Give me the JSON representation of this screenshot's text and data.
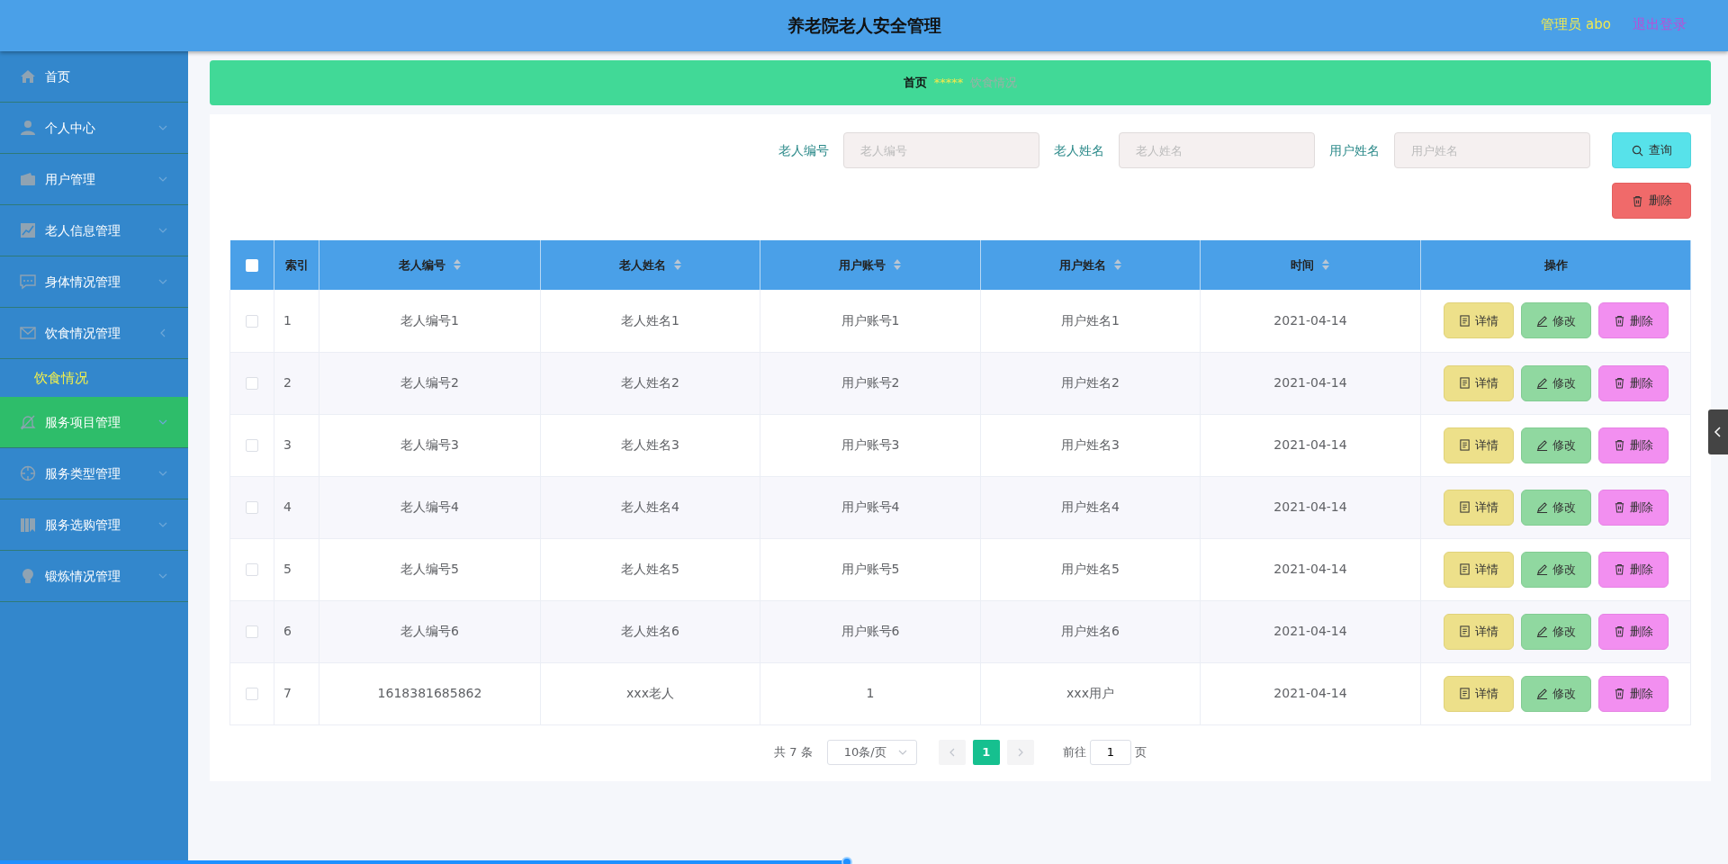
{
  "header": {
    "title": "养老院老人安全管理",
    "user": "管理员 abo",
    "logout": "退出登录"
  },
  "sidebar": {
    "items": [
      {
        "label": "首页",
        "kind": "link",
        "selected": false
      },
      {
        "label": "个人中心",
        "kind": "menu",
        "expanded": false,
        "selected": false
      },
      {
        "label": "用户管理",
        "kind": "menu",
        "expanded": false,
        "selected": false
      },
      {
        "label": "老人信息管理",
        "kind": "menu",
        "expanded": false,
        "selected": false
      },
      {
        "label": "身体情况管理",
        "kind": "menu",
        "expanded": false,
        "selected": false
      },
      {
        "label": "饮食情况管理",
        "kind": "menu",
        "expanded": true,
        "selected": false,
        "children": [
          {
            "label": "饮食情况",
            "selected": false
          }
        ]
      },
      {
        "label": "服务项目管理",
        "kind": "menu",
        "expanded": false,
        "selected": true
      },
      {
        "label": "服务类型管理",
        "kind": "menu",
        "expanded": false,
        "selected": false
      },
      {
        "label": "服务选购管理",
        "kind": "menu",
        "expanded": false,
        "selected": false
      },
      {
        "label": "锻炼情况管理",
        "kind": "menu",
        "expanded": false,
        "selected": false
      }
    ]
  },
  "breadcrumb": {
    "items": [
      "首页",
      "饮食情况"
    ],
    "separator": "*****"
  },
  "search": {
    "fields": [
      {
        "label": "老人编号",
        "placeholder": "老人编号"
      },
      {
        "label": "老人姓名",
        "placeholder": "老人姓名"
      },
      {
        "label": "用户姓名",
        "placeholder": "用户姓名"
      }
    ],
    "search_button": "查询",
    "delete_button": "删除"
  },
  "table": {
    "select_all": {
      "checked": false
    },
    "columns": [
      {
        "label": "索引",
        "sortable": false
      },
      {
        "label": "老人编号",
        "sortable": true
      },
      {
        "label": "老人姓名",
        "sortable": true
      },
      {
        "label": "用户账号",
        "sortable": true
      },
      {
        "label": "用户姓名",
        "sortable": true
      },
      {
        "label": "时间",
        "sortable": true
      },
      {
        "label": "操作",
        "sortable": false
      }
    ],
    "rows": [
      {
        "checked": false,
        "cells": [
          "1",
          "老人编号1",
          "老人姓名1",
          "用户账号1",
          "用户姓名1",
          "2021-04-14"
        ],
        "actions": [
          "详情",
          "修改",
          "删除"
        ]
      },
      {
        "checked": false,
        "cells": [
          "2",
          "老人编号2",
          "老人姓名2",
          "用户账号2",
          "用户姓名2",
          "2021-04-14"
        ],
        "actions": [
          "详情",
          "修改",
          "删除"
        ]
      },
      {
        "checked": false,
        "cells": [
          "3",
          "老人编号3",
          "老人姓名3",
          "用户账号3",
          "用户姓名3",
          "2021-04-14"
        ],
        "actions": [
          "详情",
          "修改",
          "删除"
        ]
      },
      {
        "checked": false,
        "cells": [
          "4",
          "老人编号4",
          "老人姓名4",
          "用户账号4",
          "用户姓名4",
          "2021-04-14"
        ],
        "actions": [
          "详情",
          "修改",
          "删除"
        ]
      },
      {
        "checked": false,
        "cells": [
          "5",
          "老人编号5",
          "老人姓名5",
          "用户账号5",
          "用户姓名5",
          "2021-04-14"
        ],
        "actions": [
          "详情",
          "修改",
          "删除"
        ]
      },
      {
        "checked": false,
        "cells": [
          "6",
          "老人编号6",
          "老人姓名6",
          "用户账号6",
          "用户姓名6",
          "2021-04-14"
        ],
        "actions": [
          "详情",
          "修改",
          "删除"
        ]
      },
      {
        "checked": false,
        "cells": [
          "7",
          "1618381685862",
          "xxx老人",
          "1",
          "xxx用户",
          "2021-04-14"
        ],
        "actions": [
          "详情",
          "修改",
          "删除"
        ]
      }
    ]
  },
  "pagination": {
    "total": "共 7 条",
    "page_size": "10条/页",
    "pages": [
      {
        "label": "1",
        "selected": true
      }
    ],
    "goto_label": "前往",
    "goto_value": "1",
    "goto_suffix": "页"
  },
  "player": {
    "level": 0.49
  }
}
